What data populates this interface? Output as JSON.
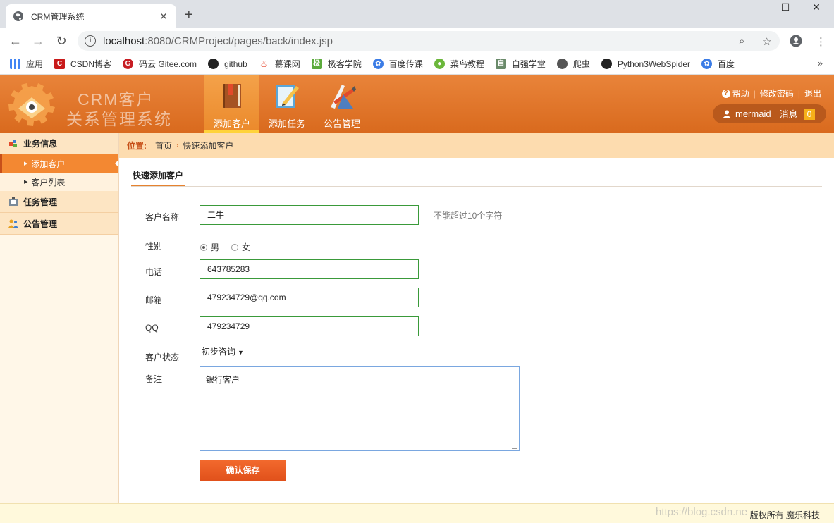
{
  "browser": {
    "tab_title": "CRM管理系统",
    "url_host": "localhost",
    "url_rest": ":8080/CRMProject/pages/back/index.jsp",
    "bookmarks": [
      {
        "label": "应用",
        "icon": "apps-grid-icon",
        "color": "#4285f4"
      },
      {
        "label": "CSDN博客",
        "icon": "csdn-icon",
        "color": "#c91a1a"
      },
      {
        "label": "码云 Gitee.com",
        "icon": "gitee-icon",
        "color": "#c71d23"
      },
      {
        "label": "github",
        "icon": "github-icon",
        "color": "#222222"
      },
      {
        "label": "慕课网",
        "icon": "imooc-icon",
        "color": "#e5452c"
      },
      {
        "label": "极客学院",
        "icon": "jikexueyuan-icon",
        "color": "#5cab3c"
      },
      {
        "label": "百度传课",
        "icon": "baidu-paw-icon",
        "color": "#3b7ce6"
      },
      {
        "label": "菜鸟教程",
        "icon": "runoob-icon",
        "color": "#6bb73b"
      },
      {
        "label": "自强学堂",
        "icon": "ziqiang-icon",
        "color": "#6a8a6a"
      },
      {
        "label": "爬虫",
        "icon": "globe-icon",
        "color": "#555555"
      },
      {
        "label": "Python3WebSpider",
        "icon": "github-icon",
        "color": "#222222"
      },
      {
        "label": "百度",
        "icon": "baidu-paw-icon",
        "color": "#3b7ce6"
      }
    ]
  },
  "header": {
    "brand_line1": "CRM客户",
    "brand_line2": "关系管理系统",
    "nav": [
      {
        "label": "添加客户",
        "icon": "book-icon",
        "active": true
      },
      {
        "label": "添加任务",
        "icon": "notepad-pencil-icon",
        "active": false
      },
      {
        "label": "公告管理",
        "icon": "pencil-ruler-icon",
        "active": false
      }
    ],
    "links": {
      "help": "帮助",
      "change_password": "修改密码",
      "logout": "退出"
    },
    "user": {
      "name": "mermaid",
      "messages_label": "消息",
      "messages_count": "0"
    }
  },
  "sidebar": {
    "groups": [
      {
        "label": "业务信息",
        "items": [
          "添加客户",
          "客户列表"
        ]
      },
      {
        "label": "任务管理",
        "items": []
      },
      {
        "label": "公告管理",
        "items": []
      }
    ]
  },
  "breadcrumb": {
    "label": "位置:",
    "home": "首页",
    "current": "快速添加客户"
  },
  "form": {
    "section_title": "快速添加客户",
    "name_label": "客户名称",
    "name_value": "二牛",
    "name_hint": "不能超过10个字符",
    "gender_label": "性别",
    "gender_male": "男",
    "gender_female": "女",
    "phone_label": "电话",
    "phone_value": "643785283",
    "email_label": "邮箱",
    "email_value": "479234729@qq.com",
    "qq_label": "QQ",
    "qq_value": "479234729",
    "status_label": "客户状态",
    "status_value": "初步咨询",
    "remark_label": "备注",
    "remark_value": "银行客户",
    "save_label": "确认保存"
  },
  "footer": {
    "copyright": "版权所有 魔乐科技",
    "watermark": "https://blog.csdn.ne"
  },
  "colors": {
    "accent": "#e6822f",
    "header": "#d96a1e",
    "input_border": "#3a9a3a",
    "button": "#e0501a"
  }
}
